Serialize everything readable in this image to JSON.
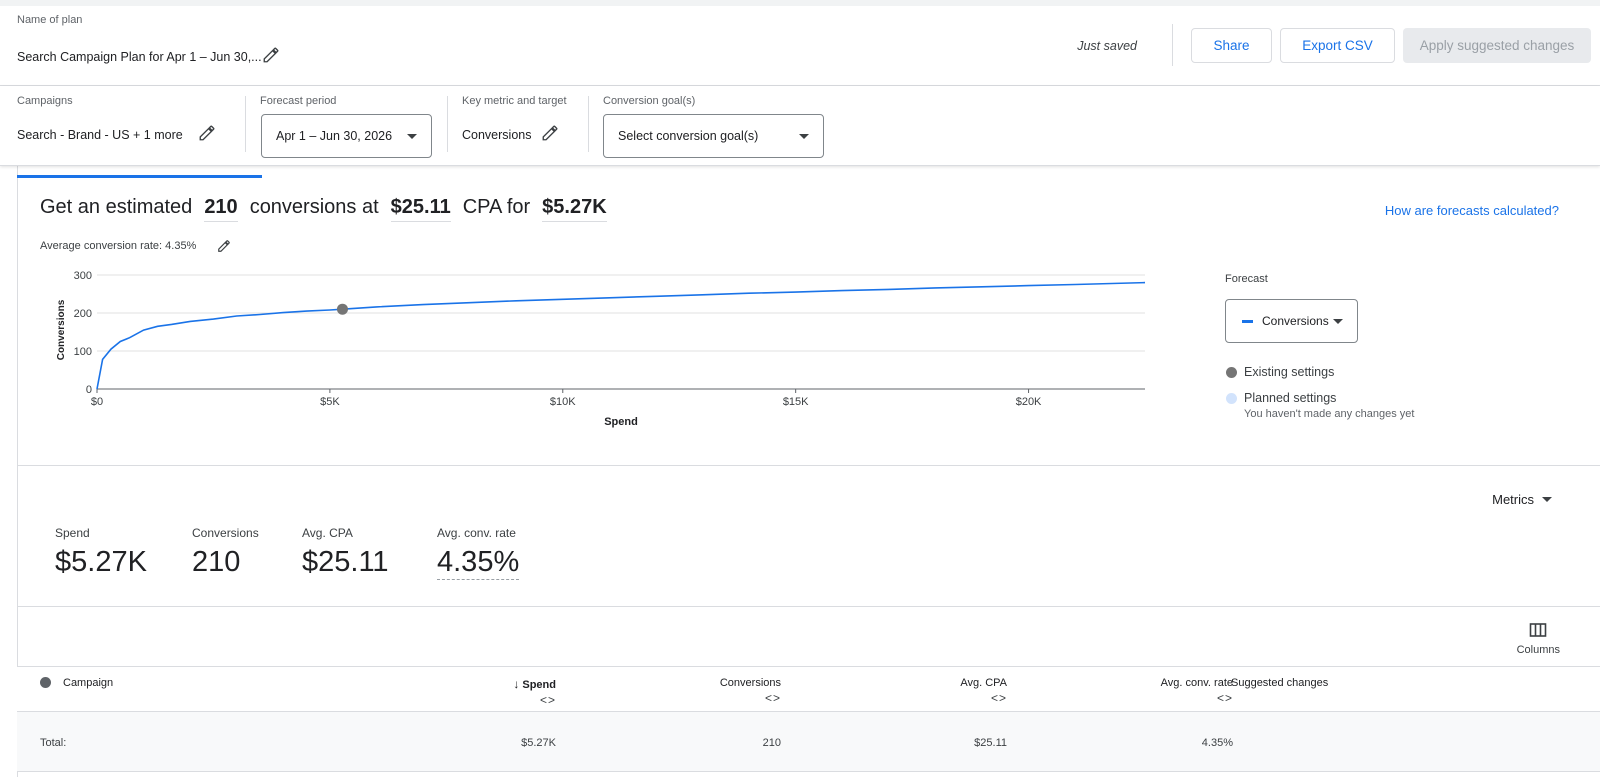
{
  "header": {
    "plan_name_label": "Name of plan",
    "plan_name": "Search Campaign Plan for Apr 1 – Jun 30,...",
    "saved_status": "Just saved",
    "share_label": "Share",
    "export_label": "Export CSV",
    "apply_label": "Apply suggested changes"
  },
  "settings": {
    "campaigns_label": "Campaigns",
    "campaigns_value": "Search - Brand - US + 1 more",
    "period_label": "Forecast period",
    "period_value": "Apr 1 – Jun 30, 2026",
    "metric_label": "Key metric and target",
    "metric_value": "Conversions",
    "goal_label": "Conversion goal(s)",
    "goal_value": "Select conversion goal(s)"
  },
  "summary": {
    "prefix": "Get an estimated",
    "conversions": "210",
    "mid1": "conversions at",
    "cpa": "$25.11",
    "mid2": "CPA for",
    "spend": "$5.27K",
    "forecast_link": "How are forecasts calculated?",
    "avg_rate_text": "Average conversion rate: 4.35%"
  },
  "legend": {
    "forecast_label": "Forecast",
    "dropdown_value": "Conversions",
    "existing": "Existing settings",
    "planned": "Planned settings",
    "planned_sub": "You haven't made any changes yet",
    "line_color": "#1a73e8",
    "existing_color": "#757575",
    "planned_color": "#d2e3fc"
  },
  "chart_data": {
    "type": "line",
    "xlabel": "Spend",
    "ylabel": "Conversions",
    "xlim": [
      0,
      22500
    ],
    "ylim": [
      0,
      300
    ],
    "xticks": [
      "$0",
      "$5K",
      "$10K",
      "$15K",
      "$20K"
    ],
    "xtick_values": [
      0,
      5000,
      10000,
      15000,
      20000
    ],
    "yticks": [
      "0",
      "100",
      "200",
      "300"
    ],
    "ytick_values": [
      0,
      100,
      200,
      300
    ],
    "series": [
      {
        "x": [
          0,
          120,
          300,
          500,
          700,
          1000,
          1300,
          1600,
          2000,
          2500,
          3000,
          3500,
          4000,
          4500,
          5000,
          5270,
          6000,
          7000,
          8000,
          9000,
          10000,
          11000,
          12000,
          13000,
          14000,
          15000,
          16000,
          17000,
          18000,
          19000,
          20000,
          21000,
          22500
        ],
        "y": [
          0,
          78,
          105,
          125,
          135,
          155,
          165,
          170,
          178,
          184,
          192,
          196,
          201,
          205,
          208,
          210,
          216,
          222,
          227,
          232,
          236,
          240,
          244,
          248,
          252,
          255,
          259,
          262,
          266,
          269,
          272,
          275,
          280
        ]
      }
    ],
    "existing_point": {
      "x": 5270,
      "y": 210
    }
  },
  "metrics": {
    "menu_label": "Metrics",
    "spend_label": "Spend",
    "spend_value": "$5.27K",
    "conv_label": "Conversions",
    "conv_value": "210",
    "cpa_label": "Avg. CPA",
    "cpa_value": "$25.11",
    "rate_label": "Avg. conv. rate",
    "rate_value": "4.35%"
  },
  "table": {
    "columns_label": "Columns",
    "headers": {
      "campaign": "Campaign",
      "spend": "Spend",
      "conversions": "Conversions",
      "cpa": "Avg. CPA",
      "rate": "Avg. conv. rate",
      "suggested": "Suggested changes"
    },
    "sort_glyph": "<>",
    "total": {
      "label": "Total:",
      "spend": "$5.27K",
      "conversions": "210",
      "cpa": "$25.11",
      "rate": "4.35%"
    }
  }
}
